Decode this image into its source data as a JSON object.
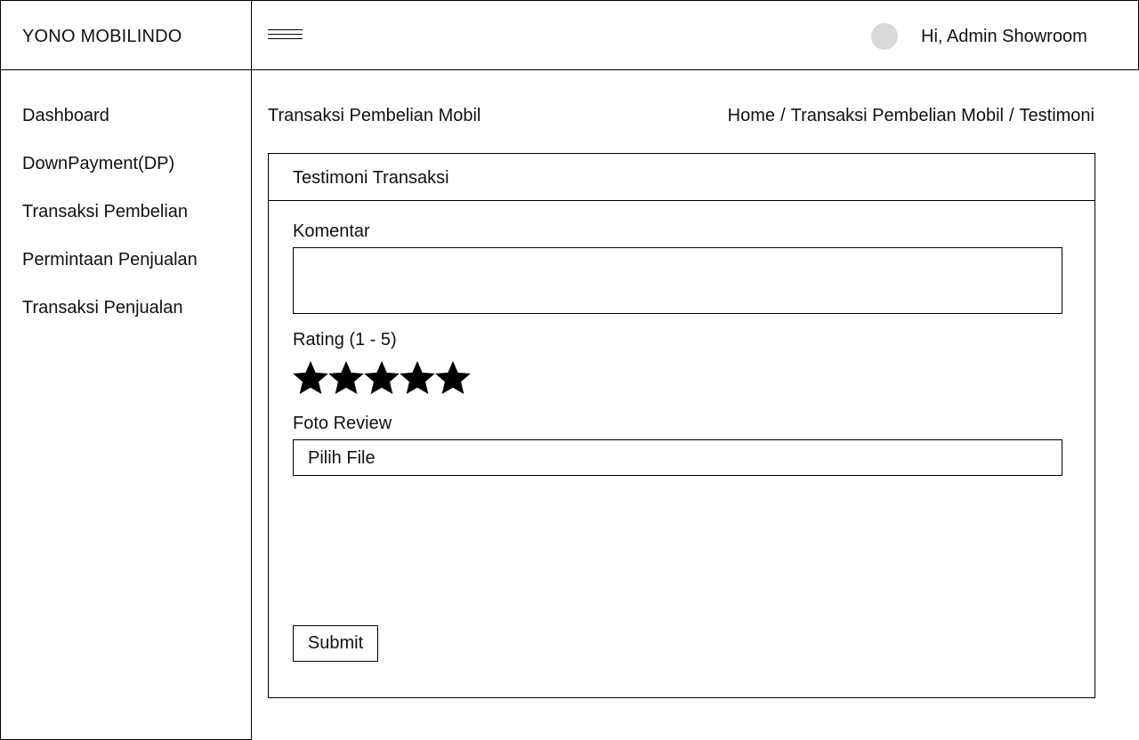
{
  "brand": {
    "name": "YONO MOBILINDO"
  },
  "header": {
    "menu_icon": "hamburger-menu-icon",
    "greeting": "Hi, Admin Showroom"
  },
  "sidebar": {
    "items": [
      {
        "label": "Dashboard"
      },
      {
        "label": "DownPayment(DP)"
      },
      {
        "label": "Transaksi Pembelian"
      },
      {
        "label": "Permintaan Penjualan"
      },
      {
        "label": "Transaksi Penjualan"
      }
    ]
  },
  "page": {
    "title": "Transaksi Pembelian Mobil",
    "breadcrumb": [
      "Home",
      "Transaksi Pembelian Mobil",
      "Testimoni"
    ],
    "breadcrumb_separator": "/"
  },
  "card": {
    "title": "Testimoni Transaksi",
    "comment_label": "Komentar",
    "comment_value": "",
    "rating_label": "Rating (1 - 5)",
    "rating_value": 5,
    "rating_max": 5,
    "star_color": "#000000",
    "photo_label": "Foto Review",
    "file_button": "Pilih File",
    "submit_label": "Submit"
  }
}
